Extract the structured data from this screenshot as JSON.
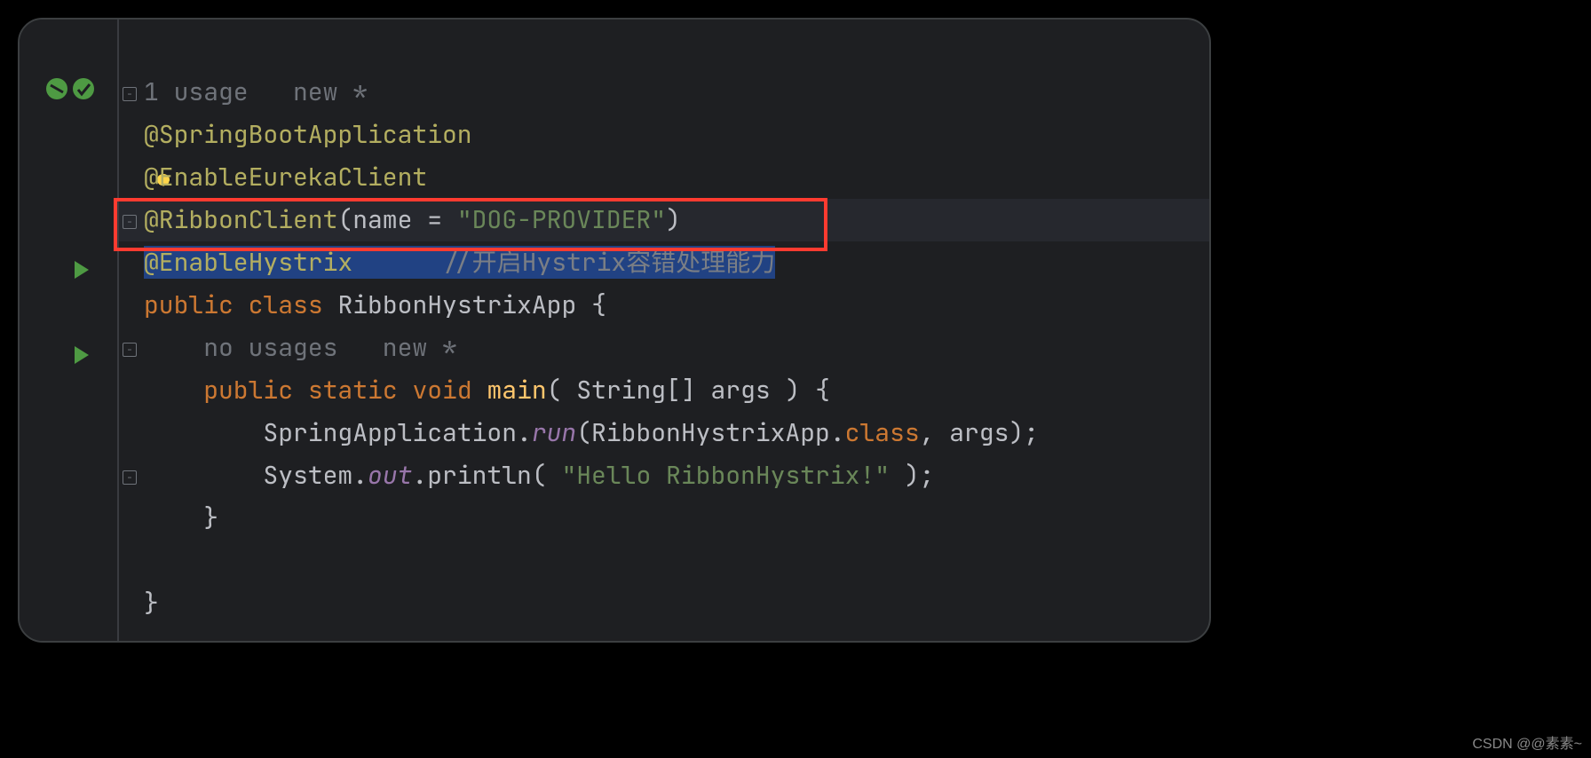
{
  "hints": {
    "top": "1 usage   new *",
    "inner": "no usages   new *"
  },
  "code": {
    "l1_ann": "@SpringBootApplication",
    "l2_ann": "@EnableEurekaClient",
    "l3_ann": "@RibbonClient",
    "l3_rest1": "(name = ",
    "l3_str": "\"DOG-PROVIDER\"",
    "l3_rest2": ")",
    "l4_ann": "@EnableHystrix",
    "l4_gap": "      ",
    "l4_comment": "//开启Hystrix容错处理能力",
    "l5_kw1": "public",
    "l5_kw2": "class",
    "l5_name": "RibbonHystrixApp",
    "l5_brace": " {",
    "l6_indent": "    ",
    "l6_kw1": "public",
    "l6_kw2": "static",
    "l6_kw3": "void",
    "l6_name": "main",
    "l6_params": "( String[] args ) {",
    "l7_indent": "        ",
    "l7_a": "SpringApplication.",
    "l7_run": "run",
    "l7_b": "(RibbonHystrixApp.",
    "l7_class": "class",
    "l7_c": ", args);",
    "l8_indent": "        ",
    "l8_a": "System.",
    "l8_out": "out",
    "l8_b": ".println( ",
    "l8_str": "\"Hello RibbonHystrix!\"",
    "l8_c": " );",
    "l9_indent": "    ",
    "l9_brace": "}",
    "l11_brace": "}"
  },
  "watermark": "CSDN @@素素~"
}
